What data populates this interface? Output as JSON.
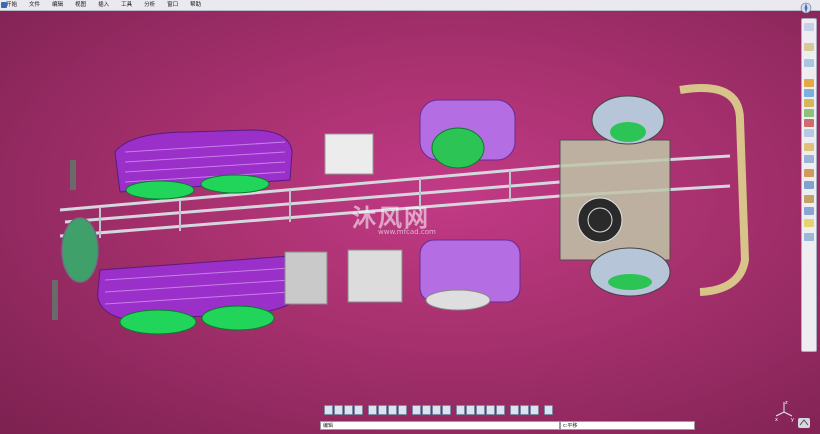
{
  "menubar": {
    "items": [
      "开始",
      "文件",
      "编辑",
      "视图",
      "插入",
      "工具",
      "分析",
      "窗口",
      "帮助"
    ]
  },
  "window_controls": {
    "minimize": "–",
    "maximize": "□",
    "close": "×"
  },
  "status": {
    "left_text": "编辑",
    "command_input": "c:平移"
  },
  "watermark": {
    "text": "沐风网",
    "url": "www.mfcad.com"
  },
  "axis": {
    "x": "x",
    "y": "y",
    "z": "z"
  },
  "colors": {
    "background": "#b1336f",
    "tires": "#21d45a",
    "fenders": "#9b2fc9",
    "frame": "#c8c8d0",
    "engine": "#e8e8e8"
  }
}
